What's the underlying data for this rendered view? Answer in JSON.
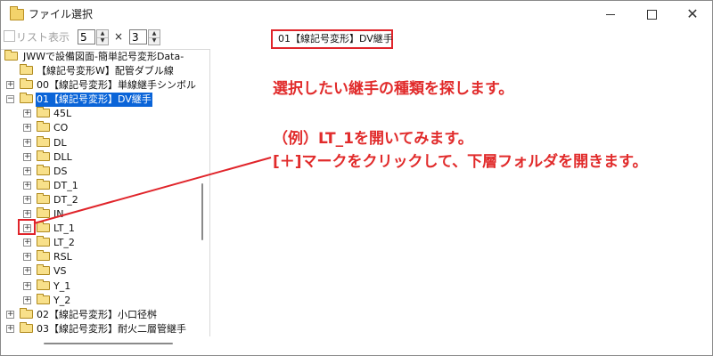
{
  "window": {
    "title": "ファイル選択",
    "controls": {
      "minimize": "—",
      "maximize": "☐",
      "close": "✕"
    }
  },
  "toolbar": {
    "list_view_label": "リスト表示",
    "list_view_checked": false,
    "columns_value": "5",
    "times_label": "×",
    "rows_value": "3"
  },
  "current_path": "01【線記号変形】DV継手",
  "tree": {
    "root": "JWWで設備図面-簡単記号変形Data-",
    "items": [
      {
        "label": "【線記号変形W】配管ダブル線",
        "expander": ""
      },
      {
        "label": "00【線記号変形】単線継手シンボル",
        "expander": "+"
      },
      {
        "label": "01【線記号変形】DV継手",
        "expander": "−",
        "selected": true
      },
      {
        "label": "45L",
        "expander": "+"
      },
      {
        "label": "CO",
        "expander": "+"
      },
      {
        "label": "DL",
        "expander": "+"
      },
      {
        "label": "DLL",
        "expander": "+"
      },
      {
        "label": "DS",
        "expander": "+"
      },
      {
        "label": "DT_1",
        "expander": "+"
      },
      {
        "label": "DT_2",
        "expander": "+"
      },
      {
        "label": "IN",
        "expander": "+"
      },
      {
        "label": "LT_1",
        "expander": "+"
      },
      {
        "label": "LT_2",
        "expander": "+"
      },
      {
        "label": "RSL",
        "expander": "+"
      },
      {
        "label": "VS",
        "expander": "+"
      },
      {
        "label": "Y_1",
        "expander": "+"
      },
      {
        "label": "Y_2",
        "expander": "+"
      },
      {
        "label": "02【線記号変形】小口径桝",
        "expander": "+"
      },
      {
        "label": "03【線記号変形】耐火二層管継手",
        "expander": "+"
      }
    ]
  },
  "annotations": {
    "line1": "選択したい継手の種類を探します。",
    "line2": "（例）LT_1を開いてみます。",
    "line3": "[＋]マークをクリックして、下層フォルダを開きます。",
    "accent_color": "#e12b2b"
  }
}
